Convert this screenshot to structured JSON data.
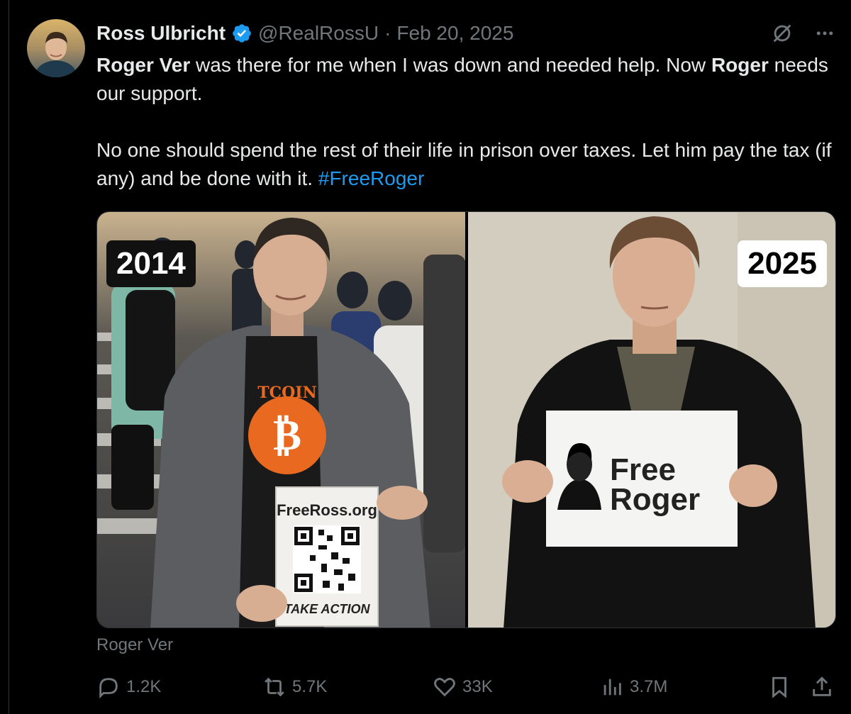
{
  "tweet": {
    "author_name": "Ross Ulbricht",
    "handle": "@RealRossU",
    "separator": "·",
    "date": "Feb 20, 2025",
    "paragraph1": {
      "bold1": "Roger Ver",
      "text1": " was there for me when I was down and needed help. Now ",
      "bold2": "Roger",
      "text2": " needs our support."
    },
    "paragraph2": {
      "text": "No one should spend the rest of their life in prison over taxes. Let him pay the tax (if any) and be done with it. ",
      "hashtag": "#FreeRoger"
    },
    "media": {
      "left_year": "2014",
      "right_year": "2025",
      "left_sign_title": "FreeRoss.org",
      "left_sign_footer": "TAKE ACTION",
      "left_shirt_text": "TCOIN",
      "right_sign_line1": "Free",
      "right_sign_line2": "Roger"
    },
    "media_caption": "Roger Ver"
  },
  "actions": {
    "replies": "1.2K",
    "reposts": "5.7K",
    "likes": "33K",
    "views": "3.7M"
  },
  "colors": {
    "background": "#000000",
    "text_primary": "#e7e9ea",
    "text_secondary": "#71767b",
    "accent": "#1d9bf0"
  },
  "icons": [
    "grok-icon",
    "more-icon",
    "reply-icon",
    "repost-icon",
    "like-icon",
    "views-icon",
    "bookmark-icon",
    "share-icon",
    "verified-badge-icon"
  ]
}
